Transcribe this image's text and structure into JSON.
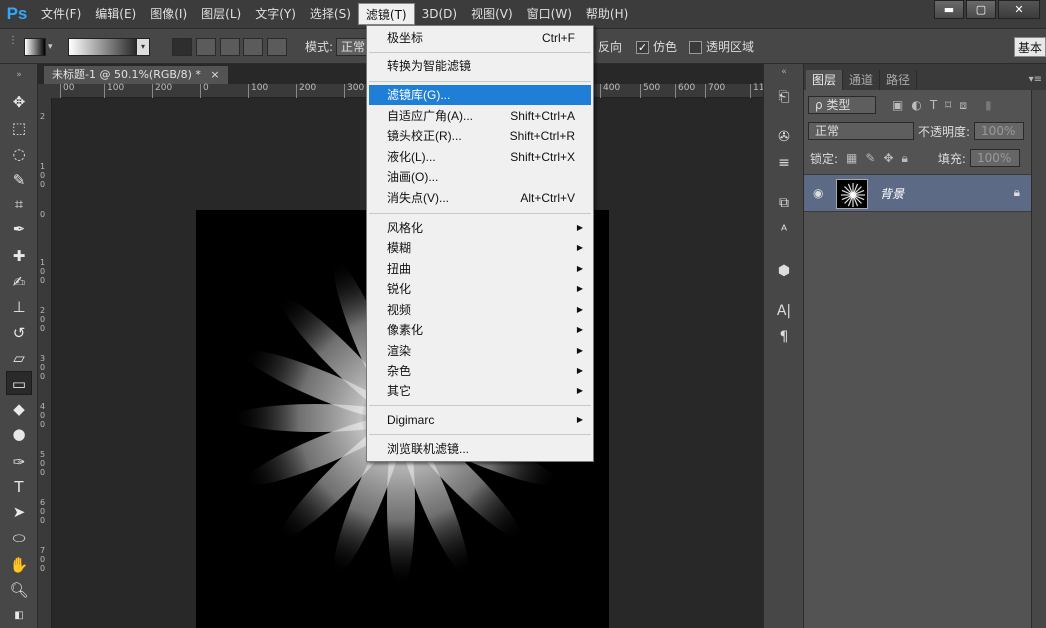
{
  "app": {
    "logo": "Ps"
  },
  "menubar": {
    "items": [
      "文件(F)",
      "编辑(E)",
      "图像(I)",
      "图层(L)",
      "文字(Y)",
      "选择(S)",
      "滤镜(T)",
      "3D(D)",
      "视图(V)",
      "窗口(W)",
      "帮助(H)"
    ],
    "active_index": 6
  },
  "window_controls": {
    "minimize": "▬",
    "maximize": "▢",
    "close": "✕"
  },
  "options": {
    "mode_label": "模式:",
    "mode_value": "正常",
    "reverse_label": "反向",
    "dither_label": "仿色",
    "dither_checked": "✓",
    "transparency_label": "透明区域",
    "workspace_label": "基本"
  },
  "document": {
    "tab_title": "未标题-1 @ 50.1%(RGB/8) *",
    "tab_close": "×",
    "ruler_h": [
      "00",
      "100",
      "200",
      "0",
      "100",
      "200",
      "300",
      "400",
      "500",
      "600",
      "700",
      "800",
      "900",
      "1000",
      "11"
    ],
    "ruler_v": [
      "2",
      "0",
      "1 0 0",
      "1 0 0",
      "0",
      "1 0 0",
      "2 0 0",
      "3 0 0",
      "4 0 0",
      "5 0 0",
      "6 0 0",
      "7 0 0"
    ]
  },
  "filter_menu": {
    "group1": [
      {
        "label": "极坐标",
        "shortcut": "Ctrl+F"
      }
    ],
    "group2": [
      {
        "label": "转换为智能滤镜",
        "shortcut": ""
      }
    ],
    "group3": [
      {
        "label": "滤镜库(G)...",
        "shortcut": "",
        "highlighted": true
      },
      {
        "label": "自适应广角(A)...",
        "shortcut": "Shift+Ctrl+A"
      },
      {
        "label": "镜头校正(R)...",
        "shortcut": "Shift+Ctrl+R"
      },
      {
        "label": "液化(L)...",
        "shortcut": "Shift+Ctrl+X"
      },
      {
        "label": "油画(O)...",
        "shortcut": ""
      },
      {
        "label": "消失点(V)...",
        "shortcut": "Alt+Ctrl+V"
      }
    ],
    "group4": [
      {
        "label": "风格化",
        "submenu": true
      },
      {
        "label": "模糊",
        "submenu": true
      },
      {
        "label": "扭曲",
        "submenu": true
      },
      {
        "label": "锐化",
        "submenu": true
      },
      {
        "label": "视频",
        "submenu": true
      },
      {
        "label": "像素化",
        "submenu": true
      },
      {
        "label": "渲染",
        "submenu": true
      },
      {
        "label": "杂色",
        "submenu": true
      },
      {
        "label": "其它",
        "submenu": true
      }
    ],
    "group5": [
      {
        "label": "Digimarc",
        "submenu": true
      }
    ],
    "group6": [
      {
        "label": "浏览联机滤镜...",
        "shortcut": ""
      }
    ]
  },
  "layers_panel": {
    "tabs": [
      "图层",
      "通道",
      "路径"
    ],
    "filter_kind": "ρ 类型",
    "blend_mode": "正常",
    "opacity_label": "不透明度:",
    "opacity_value": "100%",
    "lock_label": "锁定:",
    "fill_label": "填充:",
    "fill_value": "100%",
    "layer_name": "背景"
  },
  "colors": {
    "menu_highlight": "#1f7fd6",
    "layer_selected": "#5c6a85",
    "ps_blue": "#31a8ff"
  }
}
